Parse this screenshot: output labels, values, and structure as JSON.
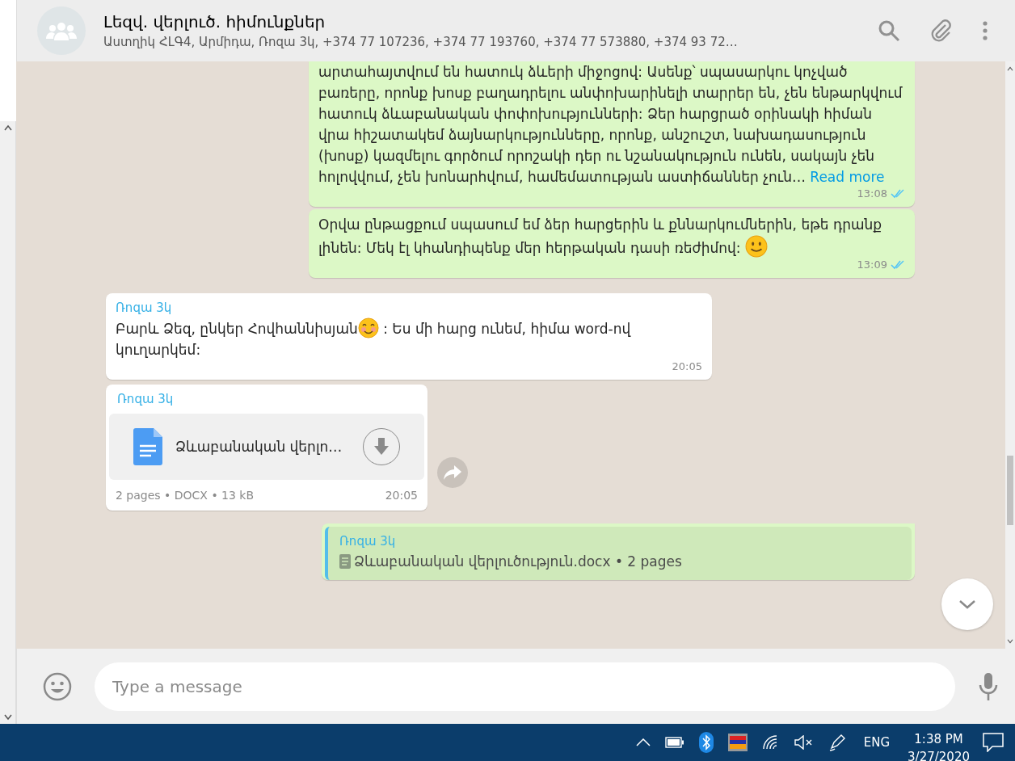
{
  "header": {
    "title": "Լեզվ. վերլուծ. հիմունքներ",
    "subtitle": "Աստղիկ ՀԼԳ4, Արմիդա, Ռոզա 3կ, +374 77 107236, +374 77 193760, +374 77 573880, +374 93 72…"
  },
  "messages": [
    {
      "kind": "outgoing-text",
      "segments": [
        {
          "kind": "text",
          "text": "արտահայտվում են հատուկ ձևերի միջոցով: Ասենք՝ սպասարկու կոչված բառերը, որոնք խոսք բաղադրելու անփոխարինելի տարրեր են, չեն ենթարկվում հատուկ ձևաբանական փոփոխությունների: Ձեր հարցրած օրինակի հիման վրա հիշատակեմ ձայնարկությունները, որոնք, անշուշտ, նախադասություն (խոսք) կազմելու գործում որոշակի դեր ու նշանակություն ունեն, սակայն չեն հոլովվում, չեն խոնարհվում, համեմատության աստիճաններ չուն…"
        }
      ],
      "link": "Read more",
      "time": "13:08",
      "read": true
    },
    {
      "kind": "outgoing-text",
      "segments": [
        {
          "kind": "text",
          "text": "Օրվա ընթացքում սպասում եմ ձեր հարցերին և քննարկումներին, եթե դրանք լինեն: Մեկ էլ կհանդիպենք մեր հերթական դասի ռեժիմով: "
        },
        {
          "kind": "smile"
        }
      ],
      "time": "13:09",
      "read": true
    },
    {
      "kind": "incoming-text",
      "sender": "Ռոզա 3կ",
      "segments": [
        {
          "kind": "text",
          "text": "Բարև Ձեզ, ընկեր Հովհաննիսյան"
        },
        {
          "kind": "blush"
        },
        {
          "kind": "text",
          "text": " : Ես մի հարց ունեմ, հիմա word-ով կուղարկեմ:"
        }
      ],
      "time": "20:05"
    },
    {
      "kind": "incoming-document",
      "sender": "Ռոզա 3կ",
      "file_name": "Ձևաբանական վերլո…",
      "meta": "2 pages • DOCX • 13 kB",
      "time": "20:05"
    },
    {
      "kind": "outgoing-quote",
      "sender": "Ռոզա 3կ",
      "quoted": "Ձևաբանական վերլուծություն.docx • 2 pages"
    }
  ],
  "composer": {
    "placeholder": "Type a message"
  },
  "taskbar": {
    "language": "ENG",
    "time": "1:38 PM",
    "date": "3/27/2020"
  }
}
